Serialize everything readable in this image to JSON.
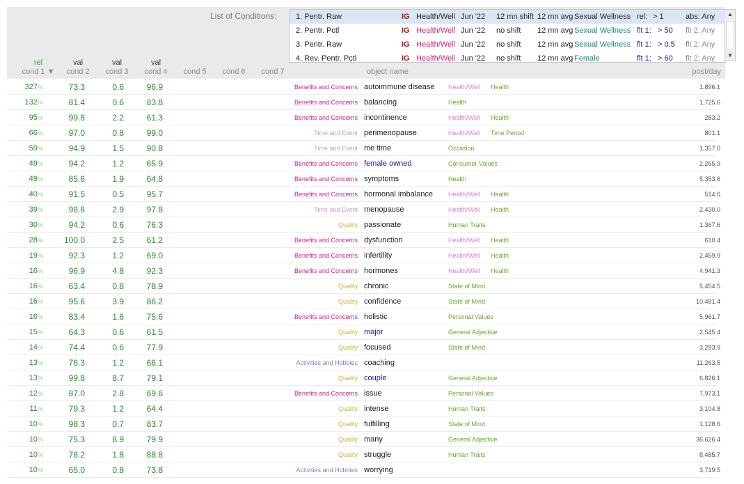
{
  "conditions": {
    "label": "List of Conditions:",
    "rows": [
      {
        "num": "1. Pentr. Raw",
        "ig": "IG",
        "category": "Health/Well",
        "date": "Jun '22",
        "shift": "12 mn shift",
        "avg": "12 mn avg",
        "object": "Sexual Wellness",
        "flt_label": "rel:",
        "flt_value": "> 1",
        "abs": "abs: Any",
        "selected": true
      },
      {
        "num": "2. Pentr. Pctl",
        "ig": "IG",
        "category": "Health/Well",
        "date": "Jun '22",
        "shift": "no shift",
        "avg": "12 mn avg",
        "object": "Sexual Wellness",
        "flt_label": "flt 1:",
        "flt_value": "> 50",
        "abs": "flt 2: Any",
        "selected": false
      },
      {
        "num": "3. Pentr. Raw",
        "ig": "IG",
        "category": "Health/Well",
        "date": "Jun '22",
        "shift": "no shift",
        "avg": "12 mn avg",
        "object": "Sexual Wellness",
        "flt_label": "flt 1:",
        "flt_value": "> 0.5",
        "abs": "flt 2: Any",
        "selected": false
      },
      {
        "num": "4. Rev. Pentr. Pctl",
        "ig": "IG",
        "category": "Health/Well",
        "date": "Jun '22",
        "shift": "no shift",
        "avg": "12 mn avg",
        "object": "Female",
        "flt_label": "flt 1:",
        "flt_value": "> 60",
        "abs": "flt 2: Any",
        "selected": false
      }
    ]
  },
  "columns": {
    "c1_top": "rel",
    "c1": "cond 1 ▼",
    "c2_top": "val",
    "c2": "cond 2",
    "c3_top": "val",
    "c3": "cond 3",
    "c4_top": "val",
    "c4": "cond 4",
    "c5": "cond 5",
    "c6": "cond 6",
    "c7": "cond 7",
    "object": "object name",
    "post_per_day": "post/day"
  },
  "colors": {
    "benefits": "#d4207f",
    "time": "#c9a0c6",
    "quality": "#c6b43a",
    "activities": "#7f82bd",
    "health_well": "#e07ad0",
    "green_cat": "#6aa52a",
    "obj_dark": "#222222",
    "obj_blue": "#1a1a9a"
  },
  "rows": [
    {
      "rel": "327",
      "v2": "73.3",
      "v3": "0.6",
      "v4": "96.9",
      "group": "Benefits and Concerns",
      "gk": "benefits",
      "obj": "autoimmune disease",
      "oc": "obj_dark",
      "cat1": "Health/Well",
      "c1k": "health_well",
      "cat2": "Health",
      "pd": "1,896.1"
    },
    {
      "rel": "132",
      "v2": "81.4",
      "v3": "0.6",
      "v4": "83.8",
      "group": "Benefits and Concerns",
      "gk": "benefits",
      "obj": "balancing",
      "oc": "obj_dark",
      "cat1": "Health",
      "c1k": "green_cat",
      "cat2": "",
      "pd": "1,725.6"
    },
    {
      "rel": "95",
      "v2": "99.8",
      "v3": "2.2",
      "v4": "61.3",
      "group": "Benefits and Concerns",
      "gk": "benefits",
      "obj": "incontinence",
      "oc": "obj_dark",
      "cat1": "Health/Well",
      "c1k": "health_well",
      "cat2": "Health",
      "pd": "283.2"
    },
    {
      "rel": "66",
      "v2": "97.0",
      "v3": "0.8",
      "v4": "99.0",
      "group": "Time and Event",
      "gk": "time",
      "obj": "perimenopause",
      "oc": "obj_dark",
      "cat1": "Health/Well",
      "c1k": "health_well",
      "cat2": "Time Period",
      "pd": "801.1"
    },
    {
      "rel": "59",
      "v2": "94.9",
      "v3": "1.5",
      "v4": "90.8",
      "group": "Time and Event",
      "gk": "time",
      "obj": "me time",
      "oc": "obj_dark",
      "cat1": "Occasion",
      "c1k": "green_cat",
      "cat2": "",
      "pd": "1,357.0"
    },
    {
      "rel": "49",
      "v2": "94.2",
      "v3": "1.2",
      "v4": "65.9",
      "group": "Benefits and Concerns",
      "gk": "benefits",
      "obj": "female owned",
      "oc": "obj_blue",
      "cat1": "Consumer Values",
      "c1k": "green_cat",
      "cat2": "",
      "pd": "2,265.9"
    },
    {
      "rel": "49",
      "v2": "85.6",
      "v3": "1.9",
      "v4": "64.8",
      "group": "Benefits and Concerns",
      "gk": "benefits",
      "obj": "symptoms",
      "oc": "obj_dark",
      "cat1": "Health",
      "c1k": "green_cat",
      "cat2": "",
      "pd": "5,353.6"
    },
    {
      "rel": "40",
      "v2": "91.5",
      "v3": "0.5",
      "v4": "95.7",
      "group": "Benefits and Concerns",
      "gk": "benefits",
      "obj": "hormonal imbalance",
      "oc": "obj_dark",
      "cat1": "Health/Well",
      "c1k": "health_well",
      "cat2": "Health",
      "pd": "514.6"
    },
    {
      "rel": "39",
      "v2": "98.8",
      "v3": "2.9",
      "v4": "97.8",
      "group": "Time and Event",
      "gk": "time",
      "obj": "menopause",
      "oc": "obj_dark",
      "cat1": "Health/Well",
      "c1k": "health_well",
      "cat2": "Health",
      "pd": "2,430.0"
    },
    {
      "rel": "30",
      "v2": "94.2",
      "v3": "0.6",
      "v4": "76.3",
      "group": "Quality",
      "gk": "quality",
      "obj": "passionate",
      "oc": "obj_dark",
      "cat1": "Human Traits",
      "c1k": "green_cat",
      "cat2": "",
      "pd": "1,367.6"
    },
    {
      "rel": "28",
      "v2": "100.0",
      "v3": "2.5",
      "v4": "61.2",
      "group": "Benefits and Concerns",
      "gk": "benefits",
      "obj": "dysfunction",
      "oc": "obj_dark",
      "cat1": "Health/Well",
      "c1k": "health_well",
      "cat2": "Health",
      "pd": "610.4"
    },
    {
      "rel": "19",
      "v2": "92.3",
      "v3": "1.2",
      "v4": "69.0",
      "group": "Benefits and Concerns",
      "gk": "benefits",
      "obj": "infertility",
      "oc": "obj_dark",
      "cat1": "Health/Well",
      "c1k": "health_well",
      "cat2": "Health",
      "pd": "2,459.9"
    },
    {
      "rel": "16",
      "v2": "96.9",
      "v3": "4.8",
      "v4": "92.3",
      "group": "Benefits and Concerns",
      "gk": "benefits",
      "obj": "hormones",
      "oc": "obj_dark",
      "cat1": "Health/Well",
      "c1k": "health_well",
      "cat2": "Health",
      "pd": "4,941.3"
    },
    {
      "rel": "16",
      "v2": "63.4",
      "v3": "0.8",
      "v4": "78.9",
      "group": "Quality",
      "gk": "quality",
      "obj": "chronic",
      "oc": "obj_dark",
      "cat1": "State of Mind",
      "c1k": "green_cat",
      "cat2": "",
      "pd": "5,454.5"
    },
    {
      "rel": "16",
      "v2": "95.6",
      "v3": "3.9",
      "v4": "86.2",
      "group": "Quality",
      "gk": "quality",
      "obj": "confidence",
      "oc": "obj_dark",
      "cat1": "State of Mind",
      "c1k": "green_cat",
      "cat2": "",
      "pd": "10,481.4"
    },
    {
      "rel": "16",
      "v2": "83.4",
      "v3": "1.6",
      "v4": "75.6",
      "group": "Benefits and Concerns",
      "gk": "benefits",
      "obj": "holistic",
      "oc": "obj_dark",
      "cat1": "Personal Values",
      "c1k": "green_cat",
      "cat2": "",
      "pd": "5,961.7"
    },
    {
      "rel": "15",
      "v2": "64.3",
      "v3": "0.6",
      "v4": "61.5",
      "group": "Quality",
      "gk": "quality",
      "obj": "major",
      "oc": "obj_blue",
      "cat1": "General Adjective",
      "c1k": "green_cat",
      "cat2": "",
      "pd": "2,545.4"
    },
    {
      "rel": "14",
      "v2": "74.4",
      "v3": "0.6",
      "v4": "77.9",
      "group": "Quality",
      "gk": "quality",
      "obj": "focused",
      "oc": "obj_dark",
      "cat1": "State of Mind",
      "c1k": "green_cat",
      "cat2": "",
      "pd": "3,293.9"
    },
    {
      "rel": "13",
      "v2": "76.3",
      "v3": "1.2",
      "v4": "66.1",
      "group": "Activities and Hobbies",
      "gk": "activities",
      "obj": "coaching",
      "oc": "obj_dark",
      "cat1": "",
      "c1k": "green_cat",
      "cat2": "",
      "pd": "11,263.5"
    },
    {
      "rel": "13",
      "v2": "99.8",
      "v3": "8.7",
      "v4": "79.1",
      "group": "Quality",
      "gk": "quality",
      "obj": "couple",
      "oc": "obj_blue",
      "cat1": "General Adjective",
      "c1k": "green_cat",
      "cat2": "",
      "pd": "6,826.1"
    },
    {
      "rel": "12",
      "v2": "87.0",
      "v3": "2.8",
      "v4": "69.6",
      "group": "Benefits and Concerns",
      "gk": "benefits",
      "obj": "issue",
      "oc": "obj_dark",
      "cat1": "Personal Values",
      "c1k": "green_cat",
      "cat2": "",
      "pd": "7,973.1"
    },
    {
      "rel": "11",
      "v2": "79.3",
      "v3": "1.2",
      "v4": "64.4",
      "group": "Quality",
      "gk": "quality",
      "obj": "intense",
      "oc": "obj_dark",
      "cat1": "Human Traits",
      "c1k": "green_cat",
      "cat2": "",
      "pd": "3,104.8"
    },
    {
      "rel": "10",
      "v2": "98.3",
      "v3": "0.7",
      "v4": "83.7",
      "group": "Quality",
      "gk": "quality",
      "obj": "fulfilling",
      "oc": "obj_dark",
      "cat1": "State of Mind",
      "c1k": "green_cat",
      "cat2": "",
      "pd": "1,128.6"
    },
    {
      "rel": "10",
      "v2": "75.3",
      "v3": "8.9",
      "v4": "79.9",
      "group": "Quality",
      "gk": "quality",
      "obj": "many",
      "oc": "obj_dark",
      "cat1": "General Adjective",
      "c1k": "green_cat",
      "cat2": "",
      "pd": "36,626.4"
    },
    {
      "rel": "10",
      "v2": "78.2",
      "v3": "1.8",
      "v4": "88.8",
      "group": "Quality",
      "gk": "quality",
      "obj": "struggle",
      "oc": "obj_dark",
      "cat1": "Human Traits",
      "c1k": "green_cat",
      "cat2": "",
      "pd": "8,485.7"
    },
    {
      "rel": "10",
      "v2": "65.0",
      "v3": "0.8",
      "v4": "73.8",
      "group": "Activities and Hobbies",
      "gk": "activities",
      "obj": "worrying",
      "oc": "obj_dark",
      "cat1": "",
      "c1k": "green_cat",
      "cat2": "",
      "pd": "3,719.5"
    }
  ]
}
